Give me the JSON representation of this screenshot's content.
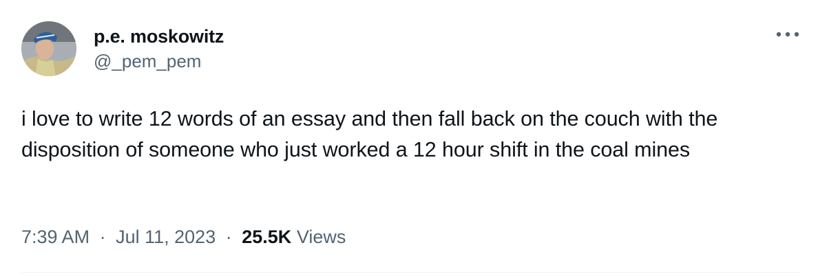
{
  "author": {
    "display_name": "p.e. moskowitz",
    "handle": "@_pem_pem"
  },
  "tweet": {
    "text": "i love to write 12 words of an essay and then fall back on the couch with the disposition of someone who just worked a 12 hour shift in the coal mines",
    "time": "7:39 AM",
    "separator": "·",
    "date": "Jul 11, 2023",
    "views_count": "25.5K",
    "views_label": "Views"
  },
  "icons": {
    "more": "more-horizontal-icon"
  },
  "colors": {
    "primary_text": "#0f1419",
    "secondary_text": "#536471",
    "divider": "#eff3f4",
    "background": "#ffffff"
  }
}
